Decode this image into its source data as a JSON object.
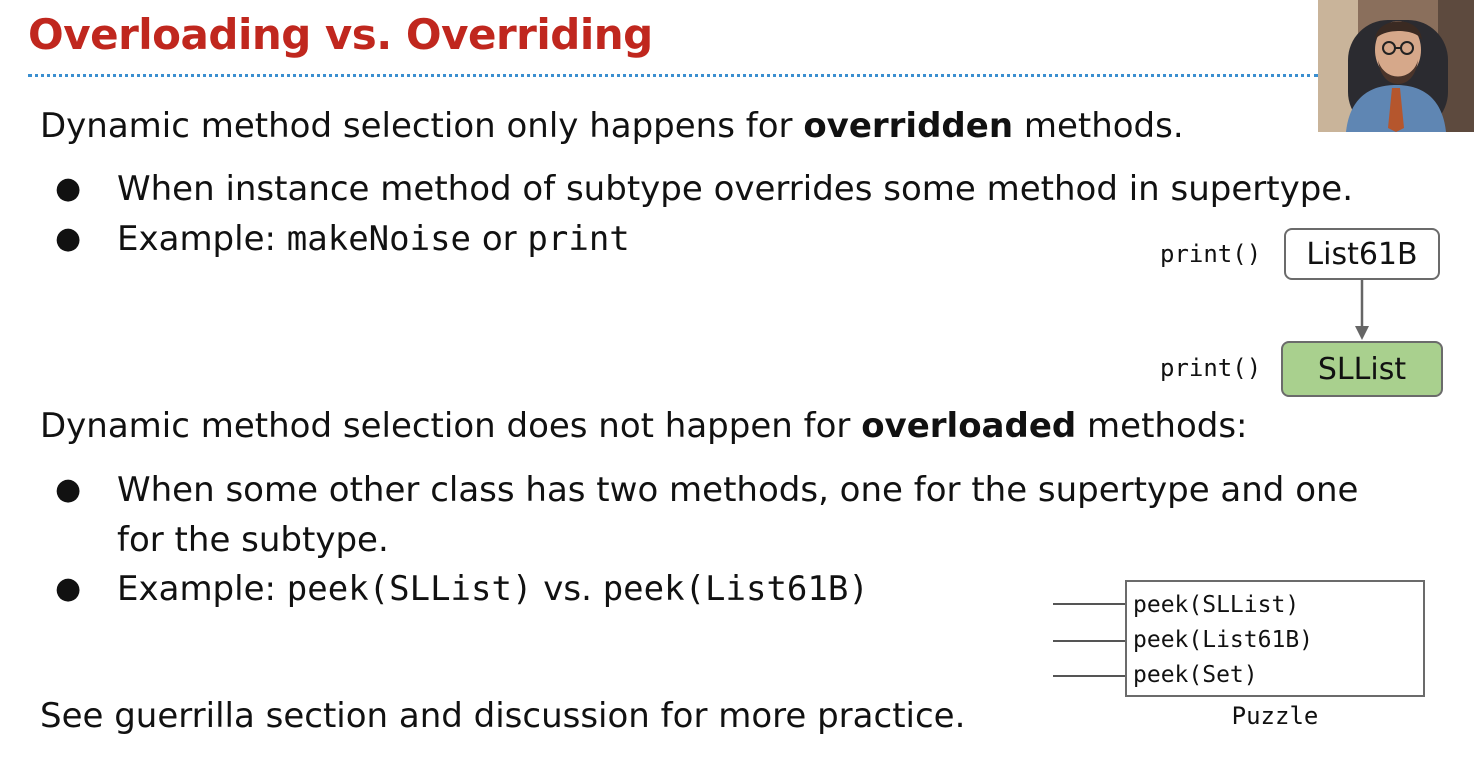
{
  "slide": {
    "title": "Overloading vs. Overriding",
    "para1_before": "Dynamic method selection only happens for ",
    "para1_bold": "overridden",
    "para1_after": " methods.",
    "bullets1": [
      {
        "text": "When instance method of subtype overrides some method in supertype."
      },
      {
        "prefix": "Example: ",
        "code1": "makeNoise",
        "mid": " or ",
        "code2": "print"
      }
    ],
    "para2_before": "Dynamic method selection does not happen for ",
    "para2_bold": "overloaded",
    "para2_after": " methods:",
    "bullets2": [
      {
        "line1": "When some other class has two methods, one for the supertype and one",
        "line2": "for the subtype."
      },
      {
        "prefix": "Example: ",
        "code1": "peek(SLList)",
        "mid": " vs. ",
        "code2": "peek(List61B)"
      }
    ],
    "footer": "See guerrilla section and discussion for more practice.",
    "bullet_glyph": "●"
  },
  "diagram": {
    "method_label_top": "print()",
    "method_label_bottom": "print()",
    "super_class": "List61B",
    "sub_class": "SLList",
    "sub_class_fill": "#a9d08e"
  },
  "puzzle": {
    "methods": [
      "peek(SLList)",
      "peek(List61B)",
      "peek(Set)"
    ],
    "caption": "Puzzle"
  },
  "colors": {
    "title": "#c0271e",
    "rule": "#3b8fd0"
  }
}
